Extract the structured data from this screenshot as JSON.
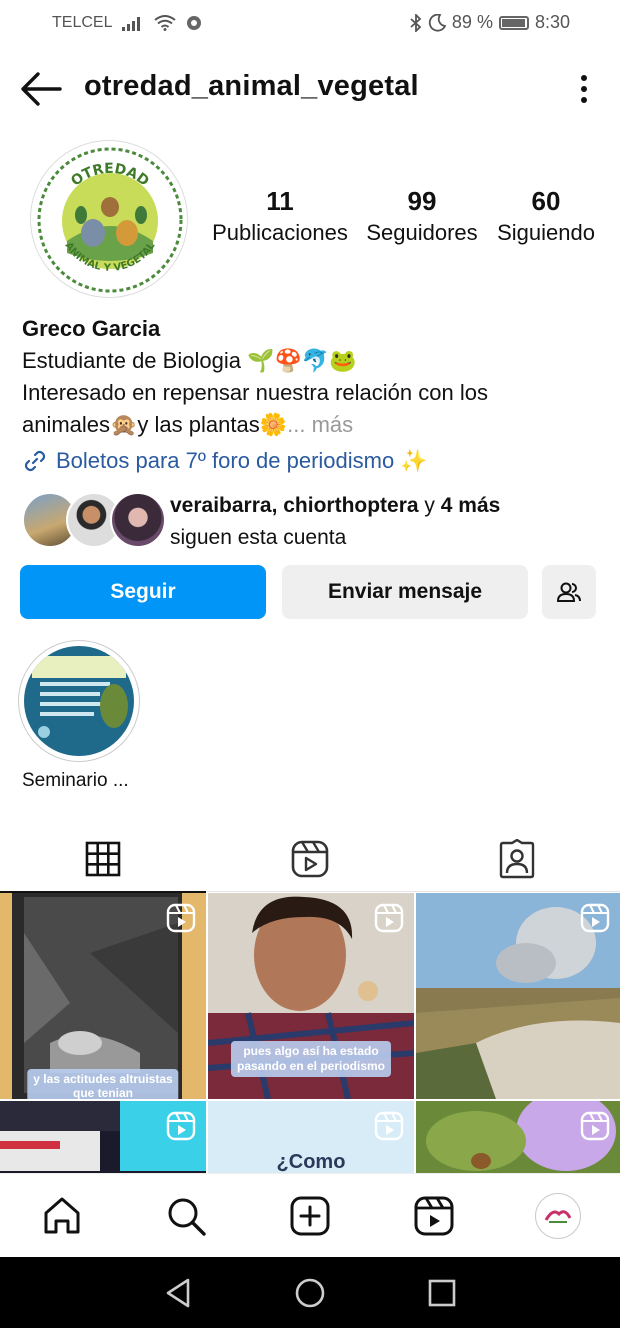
{
  "status_bar": {
    "carrier": "TELCEL",
    "battery": "89 %",
    "battery_level": 0.89,
    "time": "8:30"
  },
  "header": {
    "username": "otredad_animal_vegetal"
  },
  "logo": {
    "top_text": "OTREDAD",
    "bottom_text": "ANIMAL Y VEGETAL"
  },
  "stats": [
    {
      "value": "11",
      "label": "Publicaciones"
    },
    {
      "value": "99",
      "label": "Seguidores"
    },
    {
      "value": "60",
      "label": "Siguiendo"
    }
  ],
  "bio": {
    "name": "Greco Garcia",
    "line1": "Estudiante de Biologia 🌱🍄🐬🐸",
    "line2": "Interesado en repensar nuestra relación con los",
    "line3": "animales🙊y las plantas🌼",
    "more": "... más"
  },
  "link": {
    "text": "Boletos para 7º foro de periodismo ✨"
  },
  "followed_by": {
    "users": "veraibarra, chiorthoptera",
    "connector": " y ",
    "others": "4 más",
    "suffix": "siguen esta cuenta"
  },
  "buttons": {
    "follow": "Seguir",
    "message": "Enviar mensaje"
  },
  "highlights": [
    {
      "label": "Seminario ..."
    }
  ],
  "grid_captions": {
    "post1": [
      "y las actitudes altruistas",
      "que tenian"
    ],
    "post2": [
      "pues algo así ha estado",
      "pasando en el periodismo"
    ],
    "post5": "¿Como"
  },
  "colors": {
    "primary_button": "#0095f6",
    "link": "#2a5aa0"
  }
}
